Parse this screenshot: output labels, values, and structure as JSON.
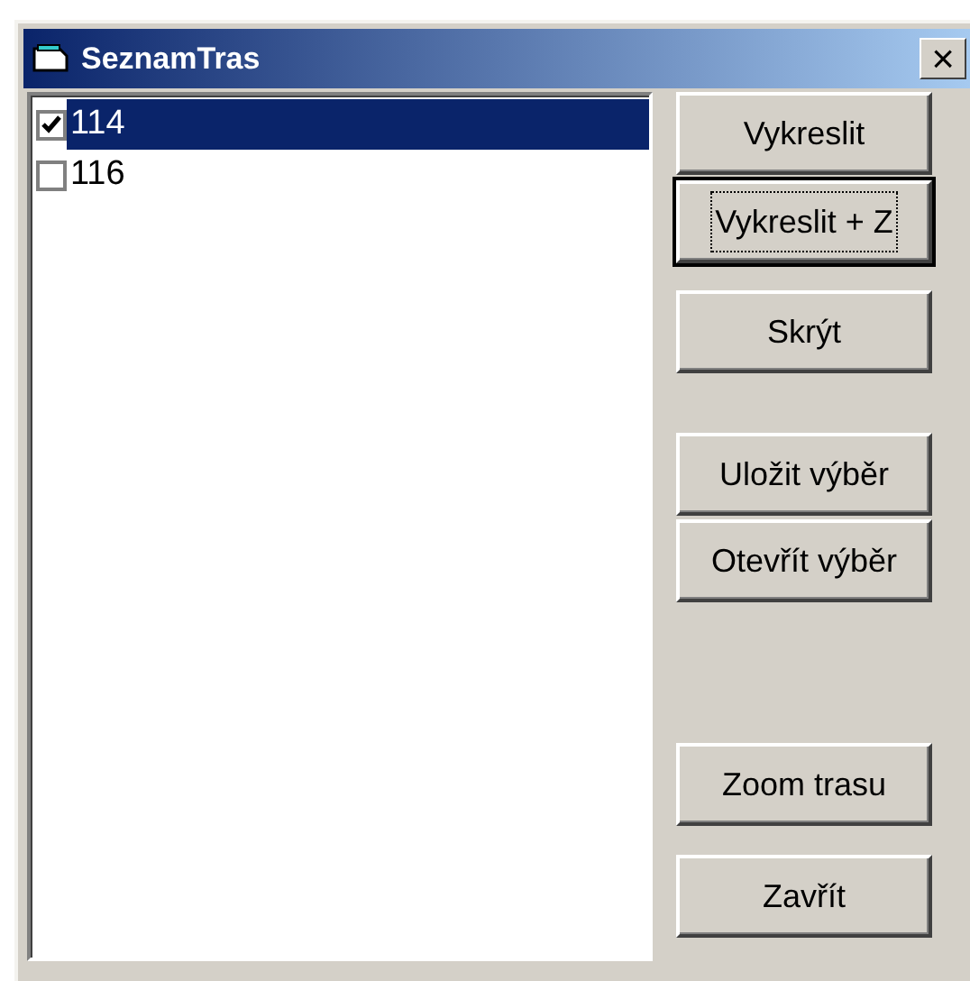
{
  "window": {
    "title": "SeznamTras",
    "close": "×"
  },
  "list": [
    {
      "label": "114",
      "checked": true,
      "selected": true
    },
    {
      "label": "116",
      "checked": false,
      "selected": false
    }
  ],
  "buttons": [
    {
      "label": "Vykreslit",
      "default": false
    },
    {
      "label": "Vykreslit + Z",
      "default": true
    },
    {
      "label": "Skrýt",
      "default": false
    },
    {
      "label": "Uložit výběr",
      "default": false
    },
    {
      "label": "Otevřít výběr",
      "default": false
    },
    {
      "label": "Zoom trasu",
      "default": false
    },
    {
      "label": "Zavřít",
      "default": false
    }
  ]
}
